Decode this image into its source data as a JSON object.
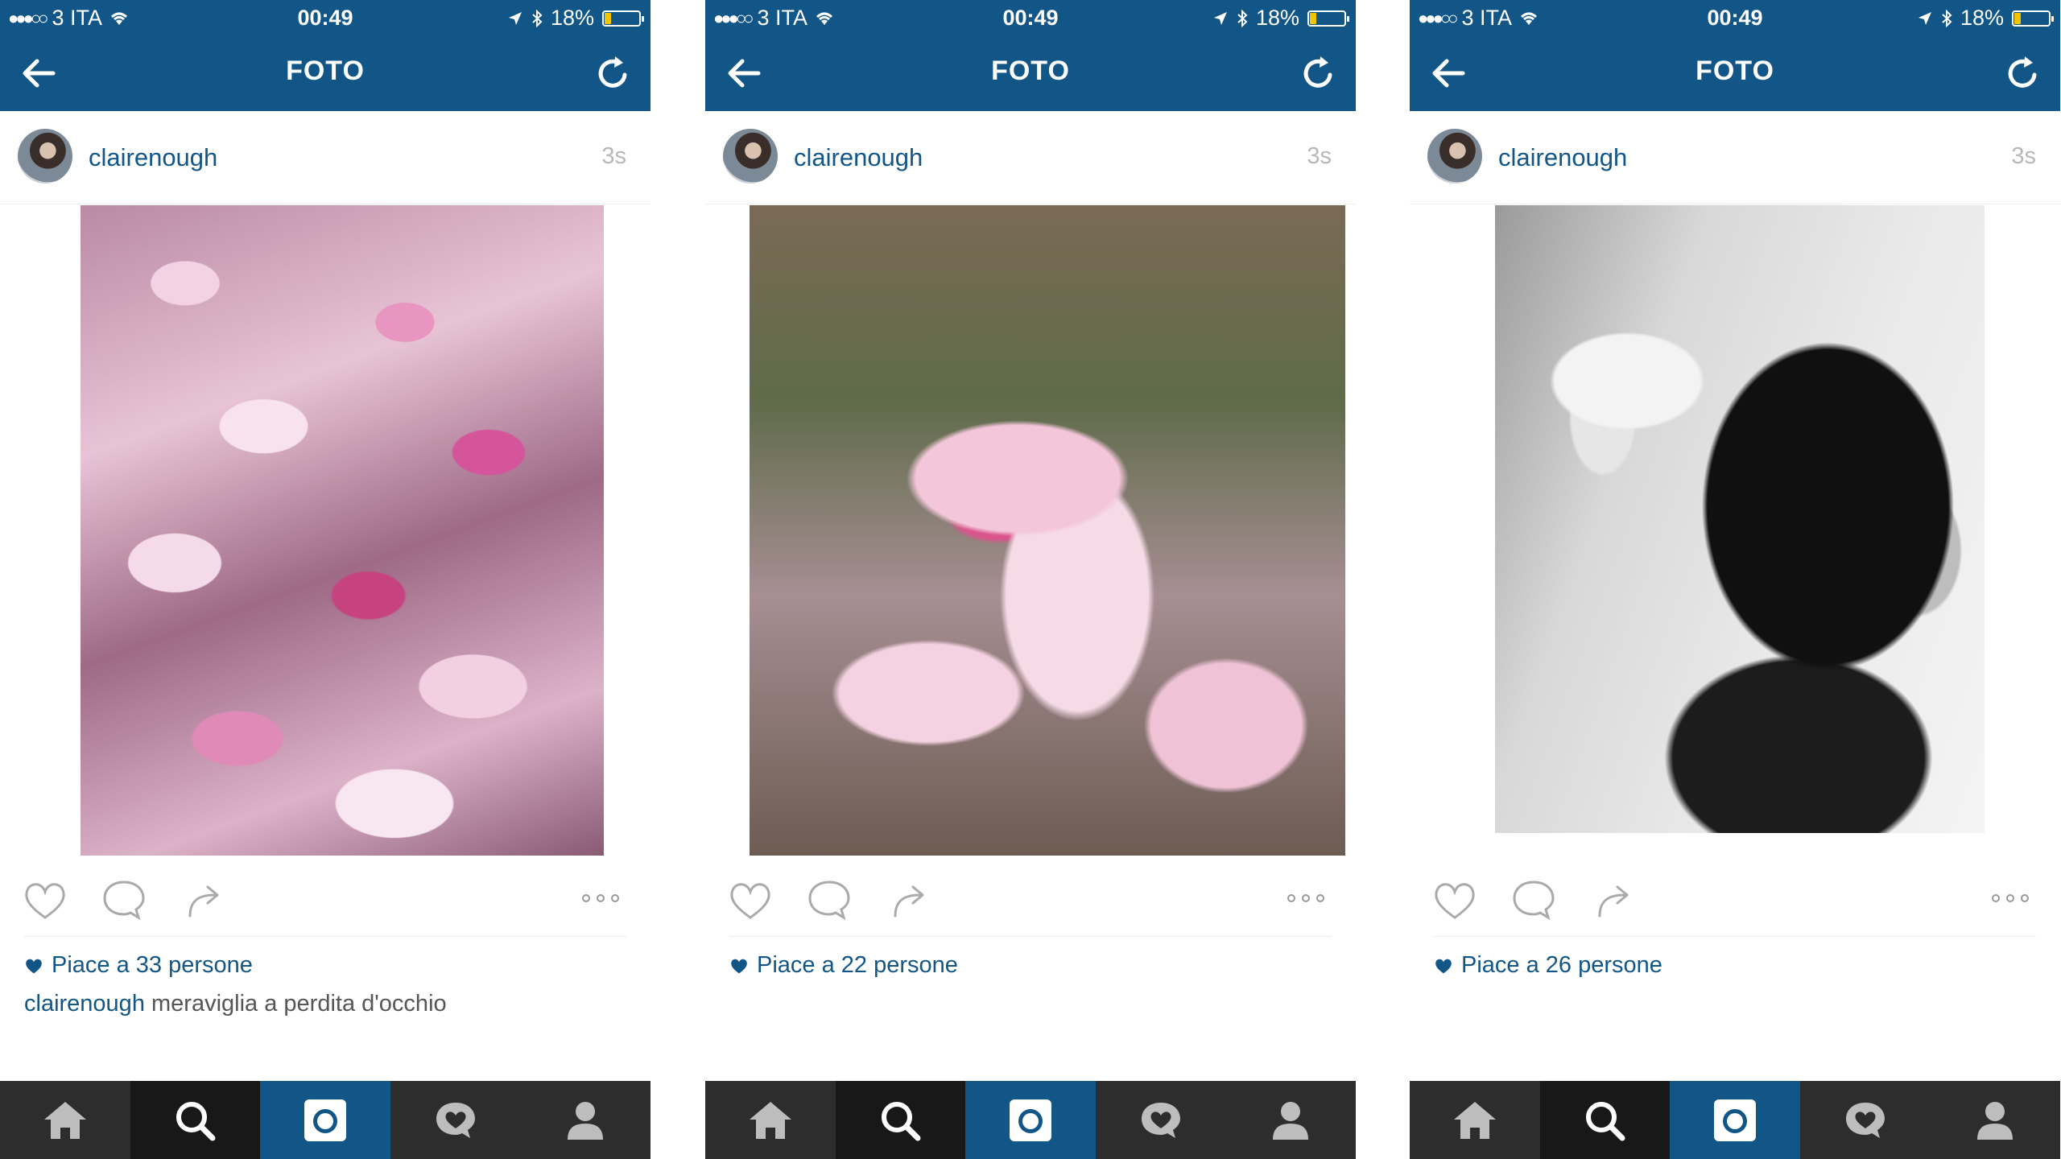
{
  "colors": {
    "brand": "#125688",
    "tabbar": "#2d2d2d",
    "battery": "#f2c500"
  },
  "status": {
    "carrier": "3 ITA",
    "time": "00:49",
    "battery": "18%"
  },
  "nav": {
    "title": "FOTO"
  },
  "tabs": [
    "home-icon",
    "search-icon",
    "camera-icon",
    "activity-icon",
    "profile-icon"
  ],
  "posts": [
    {
      "username": "clairenough",
      "time": "3s",
      "likes": "Piace a 33 persone",
      "caption_user": "clairenough",
      "caption_text": "meraviglia a perdita d'occhio"
    },
    {
      "username": "clairenough",
      "time": "3s",
      "likes": "Piace a 22 persone"
    },
    {
      "username": "clairenough",
      "time": "3s",
      "likes": "Piace a 26 persone"
    }
  ]
}
